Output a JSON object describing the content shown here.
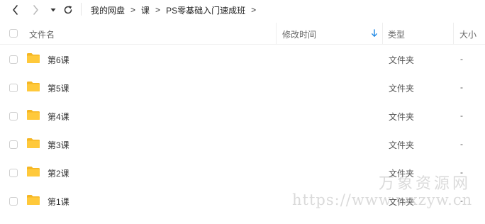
{
  "toolbar": {
    "back_icon": "chevron-left-icon",
    "forward_icon": "chevron-right-icon",
    "dropdown_icon": "caret-down-icon",
    "refresh_icon": "refresh-icon",
    "breadcrumb": [
      "我的网盘",
      "课",
      "PS零基础入门速成班"
    ],
    "separator": ">"
  },
  "table": {
    "columns": {
      "name": "文件名",
      "modified": "修改时间",
      "type": "类型",
      "size": "大小"
    },
    "sorted_by": "modified",
    "sort_direction": "descending",
    "rows": [
      {
        "name": "第6课",
        "modified": "",
        "type": "文件夹",
        "size": "-"
      },
      {
        "name": "第5课",
        "modified": "",
        "type": "文件夹",
        "size": "-"
      },
      {
        "name": "第4课",
        "modified": "",
        "type": "文件夹",
        "size": "-"
      },
      {
        "name": "第3课",
        "modified": "",
        "type": "文件夹",
        "size": "-"
      },
      {
        "name": "第2课",
        "modified": "",
        "type": "文件夹",
        "size": "-"
      },
      {
        "name": "第1课",
        "modified": "",
        "type": "文件夹",
        "size": "-"
      }
    ]
  },
  "watermark": {
    "title": "万象资源网",
    "url": "https://www.wxzyw.cn"
  },
  "colors": {
    "folder": "#FFC93B",
    "folder_back": "#F5B623",
    "sort_arrow": "#1E88E5"
  }
}
